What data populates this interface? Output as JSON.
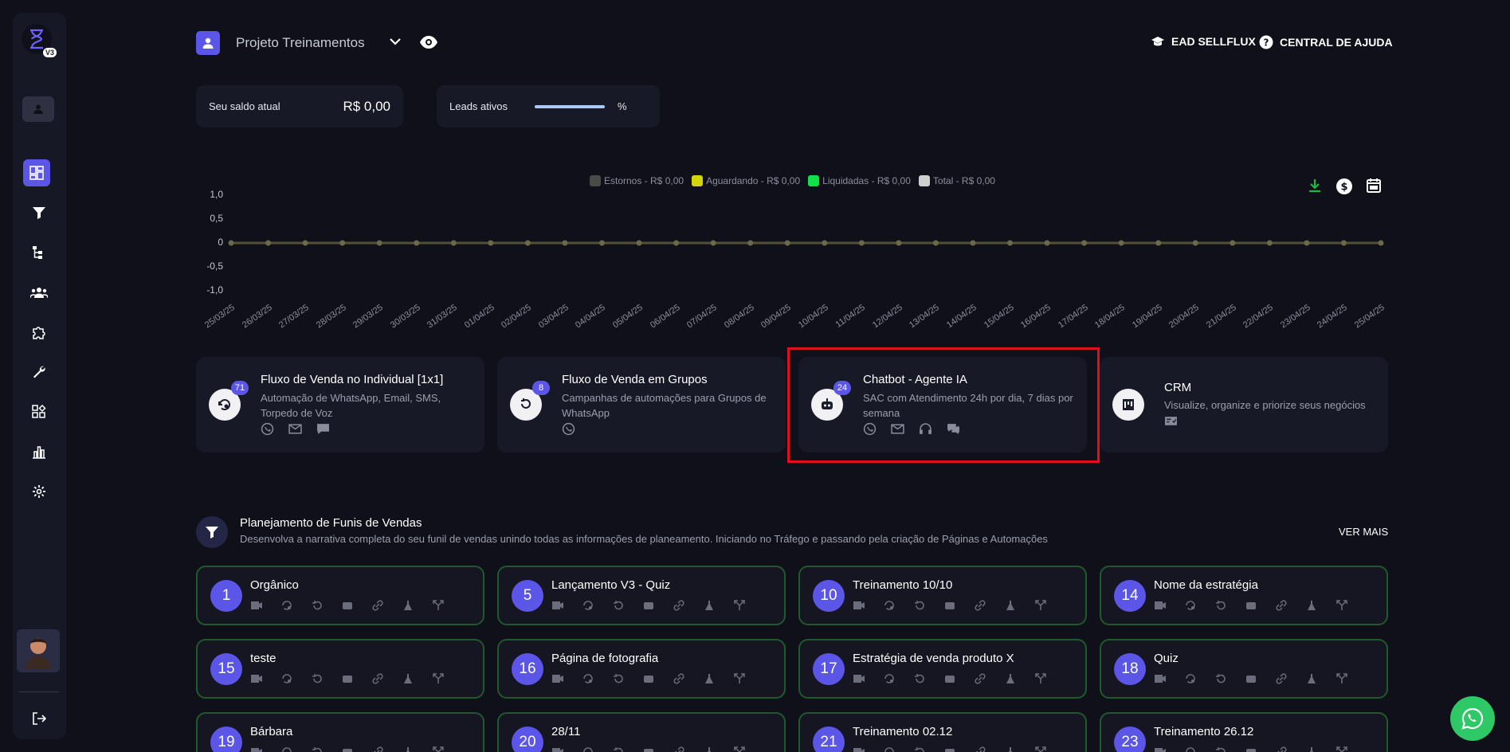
{
  "sidebar": {
    "logo_badge": "V3"
  },
  "topbar": {
    "project_name": "Projeto Treinamentos",
    "ead_label": "EAD SELLFLUX",
    "help_label": "CENTRAL DE AJUDA"
  },
  "stats": {
    "saldo_label": "Seu saldo atual",
    "saldo_value": "R$ 0,00",
    "leads_label": "Leads ativos",
    "leads_pct_symbol": "%",
    "leads_fill": 1.0
  },
  "chart_data": {
    "type": "line",
    "legend": [
      {
        "label": "Estornos - R$ 0,00",
        "color": "#4a4a4a"
      },
      {
        "label": "Aguardando - R$ 0,00",
        "color": "#d4d40a"
      },
      {
        "label": "Liquidadas - R$ 0,00",
        "color": "#12e04a"
      },
      {
        "label": "Total - R$ 0,00",
        "color": "#cfcfcf"
      }
    ],
    "x": [
      "25/03/25",
      "26/03/25",
      "27/03/25",
      "28/03/25",
      "29/03/25",
      "30/03/25",
      "31/03/25",
      "01/04/25",
      "02/04/25",
      "03/04/25",
      "04/04/25",
      "05/04/25",
      "06/04/25",
      "07/04/25",
      "08/04/25",
      "09/04/25",
      "10/04/25",
      "11/04/25",
      "12/04/25",
      "13/04/25",
      "14/04/25",
      "15/04/25",
      "16/04/25",
      "17/04/25",
      "18/04/25",
      "19/04/25",
      "20/04/25",
      "21/04/25",
      "22/04/25",
      "23/04/25",
      "24/04/25",
      "25/04/25"
    ],
    "series": [
      {
        "name": "Total - R$ 0,00",
        "values": [
          0,
          0,
          0,
          0,
          0,
          0,
          0,
          0,
          0,
          0,
          0,
          0,
          0,
          0,
          0,
          0,
          0,
          0,
          0,
          0,
          0,
          0,
          0,
          0,
          0,
          0,
          0,
          0,
          0,
          0,
          0,
          0
        ]
      }
    ],
    "ylim": [
      -1,
      1
    ],
    "yticks": [
      "1,0",
      "0,5",
      "0",
      "-0,5",
      "-1,0"
    ],
    "grid": false,
    "legend_position": "top"
  },
  "features": [
    {
      "title": "Fluxo de Venda no Individual [1x1]",
      "desc": "Automação de WhatsApp, Email, SMS, Torpedo de Voz",
      "badge": "71"
    },
    {
      "title": "Fluxo de Venda em Grupos",
      "desc": "Campanhas de automações para Grupos de WhatsApp",
      "badge": "8"
    },
    {
      "title": "Chatbot - Agente IA",
      "desc": "SAC com Atendimento 24h por dia, 7 dias por semana",
      "badge": "24"
    },
    {
      "title": "CRM",
      "desc": "Visualize, organize e priorize seus negócios",
      "badge": ""
    }
  ],
  "planning": {
    "title": "Planejamento de Funis de Vendas",
    "desc": "Desenvolva a narrativa completa do seu funil de vendas unindo todas as informações de planeamento. Iniciando no Tráfego e passando pela criação de Páginas e Automações",
    "more": "VER MAIS"
  },
  "funnels": [
    {
      "num": "1",
      "title": "Orgânico"
    },
    {
      "num": "5",
      "title": "Lançamento V3 - Quiz"
    },
    {
      "num": "10",
      "title": "Treinamento 10/10"
    },
    {
      "num": "14",
      "title": "Nome da estratégia"
    },
    {
      "num": "15",
      "title": "teste"
    },
    {
      "num": "16",
      "title": "Página de fotografia"
    },
    {
      "num": "17",
      "title": "Estratégia de venda produto X"
    },
    {
      "num": "18",
      "title": "Quiz"
    },
    {
      "num": "19",
      "title": "Bárbara"
    },
    {
      "num": "20",
      "title": "28/11"
    },
    {
      "num": "21",
      "title": "Treinamento 02.12"
    },
    {
      "num": "23",
      "title": "Treinamento 26.12"
    }
  ]
}
